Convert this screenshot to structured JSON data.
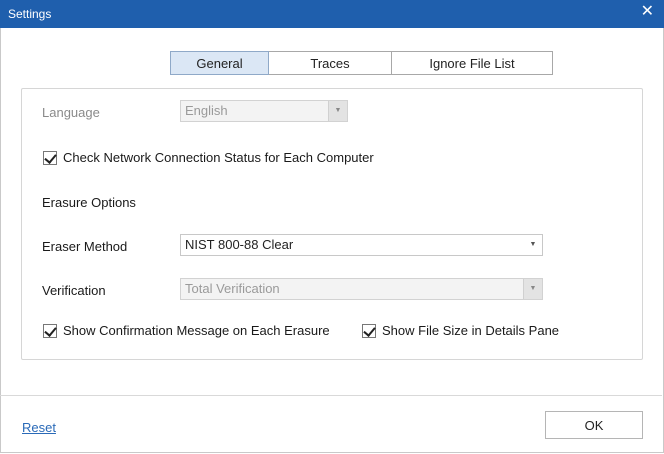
{
  "window": {
    "title": "Settings",
    "close_icon": "close-icon"
  },
  "tabs": [
    {
      "label": "General",
      "active": true
    },
    {
      "label": "Traces",
      "active": false
    },
    {
      "label": "Ignore File List",
      "active": false
    }
  ],
  "general": {
    "language_label": "Language",
    "language_value": "English",
    "check_network_label": "Check Network Connection Status for Each Computer",
    "erasure_options_heading": "Erasure Options",
    "eraser_method_label": "Eraser Method",
    "eraser_method_value": "NIST 800-88 Clear",
    "verification_label": "Verification",
    "verification_value": "Total Verification",
    "show_confirmation_label": "Show Confirmation Message on Each Erasure",
    "show_file_size_label": "Show File Size in Details Pane"
  },
  "footer": {
    "reset_label": "Reset",
    "ok_label": "OK"
  },
  "colors": {
    "titlebar": "#1f5fad",
    "active_tab": "#dbe7f5",
    "link": "#2a6ab8"
  }
}
